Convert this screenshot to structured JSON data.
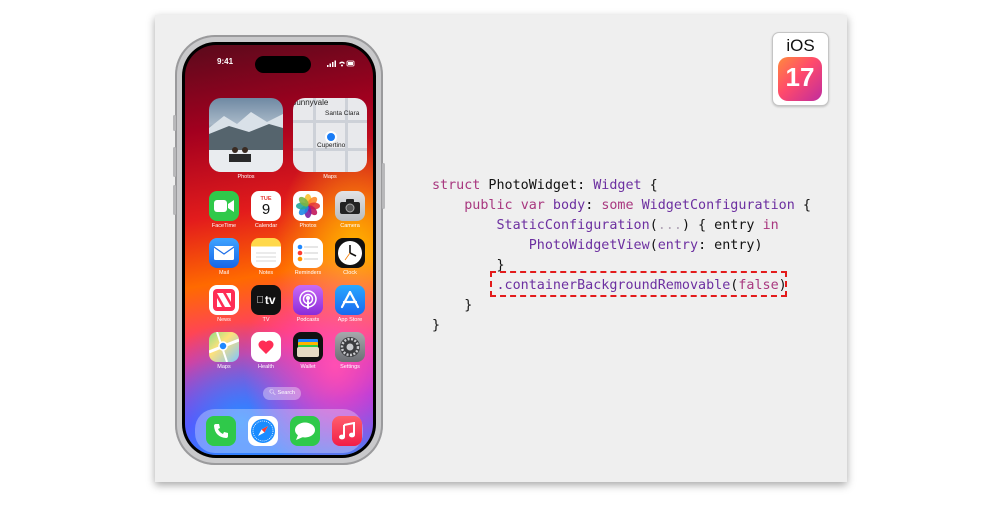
{
  "status_bar": {
    "time": "9:41"
  },
  "widgets": [
    {
      "label": "Photos"
    },
    {
      "label": "Maps",
      "places": [
        "Sunnyvale",
        "Santa Clara",
        "Cupertino"
      ]
    }
  ],
  "apps": [
    {
      "label": "FaceTime",
      "icon": "facetime-icon",
      "color": "#2fc94a"
    },
    {
      "label": "Calendar",
      "icon": "calendar-icon",
      "color": "#ffffff",
      "day": "TUE",
      "date": "9"
    },
    {
      "label": "Photos",
      "icon": "photos-icon",
      "color": "#ffffff"
    },
    {
      "label": "Camera",
      "icon": "camera-icon",
      "color": "#cfd1d4"
    },
    {
      "label": "Mail",
      "icon": "mail-icon",
      "color": "#1e88ff"
    },
    {
      "label": "Notes",
      "icon": "notes-icon",
      "color": "#ffffff"
    },
    {
      "label": "Reminders",
      "icon": "reminders-icon",
      "color": "#ffffff"
    },
    {
      "label": "Clock",
      "icon": "clock-icon",
      "color": "#111111"
    },
    {
      "label": "News",
      "icon": "news-icon",
      "color": "#ffffff"
    },
    {
      "label": "TV",
      "icon": "tv-icon",
      "color": "#111111",
      "text": "tv"
    },
    {
      "label": "Podcasts",
      "icon": "podcasts-icon",
      "color": "#a24be0"
    },
    {
      "label": "App Store",
      "icon": "app-store-icon",
      "color": "#1d8cf5"
    },
    {
      "label": "Maps",
      "icon": "maps-icon",
      "color": "#6ab0ff"
    },
    {
      "label": "Health",
      "icon": "health-icon",
      "color": "#ffffff"
    },
    {
      "label": "Wallet",
      "icon": "wallet-icon",
      "color": "#111111"
    },
    {
      "label": "Settings",
      "icon": "settings-icon",
      "color": "#8e8e93"
    }
  ],
  "search_label": "Search",
  "dock": [
    {
      "icon": "phone-icon",
      "color": "#2fc94a"
    },
    {
      "icon": "safari-icon",
      "color": "#ffffff"
    },
    {
      "icon": "messages-icon",
      "color": "#2fc94a"
    },
    {
      "icon": "music-icon",
      "color": "#fa3c5a"
    }
  ],
  "badge": {
    "os": "iOS",
    "version": "17"
  },
  "code": {
    "l1": {
      "kw": "struct",
      "name": " PhotoWidget: ",
      "type": "Widget",
      "rest": " {"
    },
    "l2": {
      "kw1": "public",
      "kw2": "var",
      "name": " body",
      "mid": ": ",
      "kw3": "some",
      "type": " WidgetConfiguration",
      "rest": " {"
    },
    "l3": {
      "fn": "StaticConfiguration",
      "open": "(",
      "placeholder": "...",
      "close": ") { entry ",
      "kw": "in"
    },
    "l4": {
      "fn": "PhotoWidgetView",
      "open": "(",
      "arg": "entry",
      "rest": ": entry)"
    },
    "l5": "}",
    "l6": {
      "fn": ".containerBackgroundRemovable",
      "open": "(",
      "kw": "false",
      "close": ")"
    },
    "l7": "}",
    "l8": "}"
  }
}
